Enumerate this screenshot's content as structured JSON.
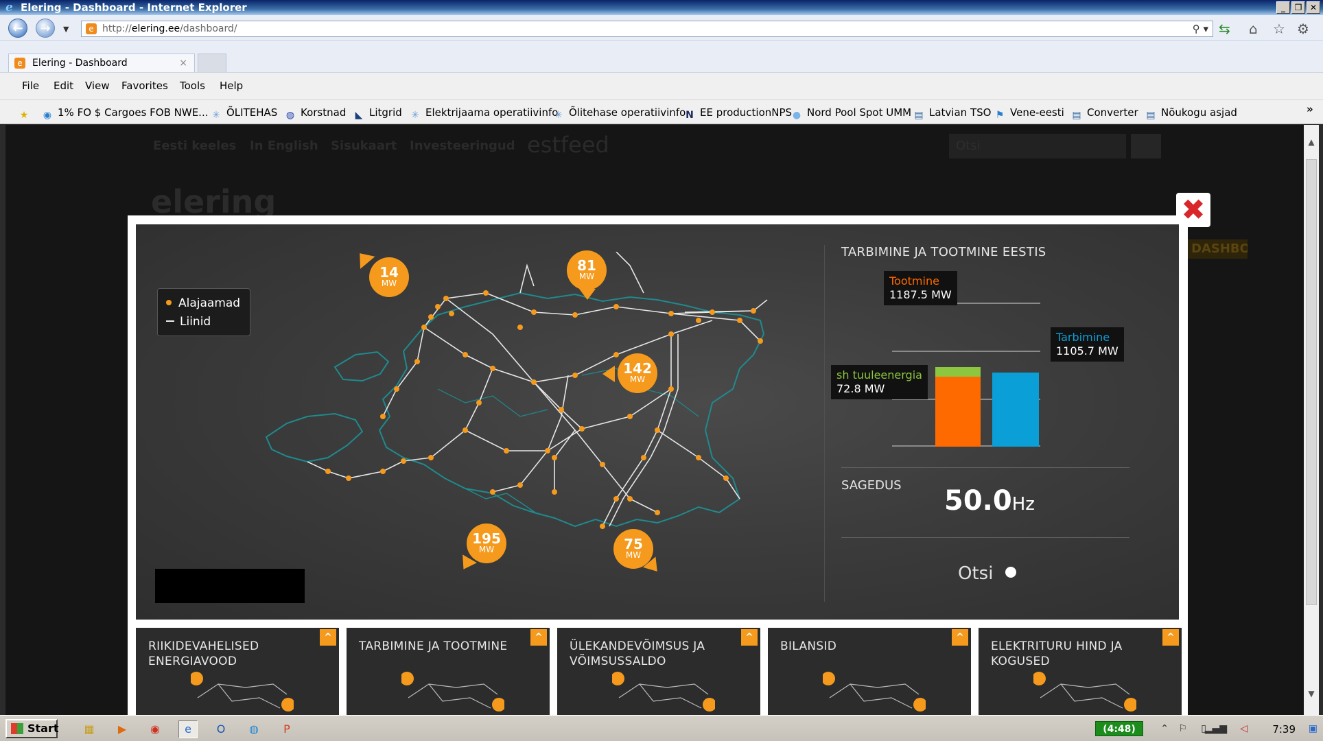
{
  "window": {
    "title": "Elering - Dashboard - Internet Explorer"
  },
  "address": {
    "url_prefix": "http://",
    "url_host": "elering.ee",
    "url_path": "/dashboard/"
  },
  "tab": {
    "label": "Elering - Dashboard"
  },
  "menu": [
    "File",
    "Edit",
    "View",
    "Favorites",
    "Tools",
    "Help"
  ],
  "favorites": [
    {
      "label": "1% FO $ Cargoes FOB NWE...",
      "icon": "globe-icon"
    },
    {
      "label": "ÕLITEHAS",
      "icon": "snowflake-icon"
    },
    {
      "label": "Korstnad",
      "icon": "chart-icon"
    },
    {
      "label": "Litgrid",
      "icon": "arrow-icon"
    },
    {
      "label": "Elektrijaama operatiivinfo",
      "icon": "snowflake-icon"
    },
    {
      "label": "Õlitehase operatiivinfo",
      "icon": "snowflake-icon"
    },
    {
      "label": "EE productionNPS",
      "icon": "n-icon"
    },
    {
      "label": "Nord Pool Spot UMM",
      "icon": "circle-icon"
    },
    {
      "label": "Latvian TSO",
      "icon": "ie-page-icon"
    },
    {
      "label": "Vene-eesti",
      "icon": "flag-icon"
    },
    {
      "label": "Converter",
      "icon": "ie-page-icon"
    },
    {
      "label": "Nõukogu asjad",
      "icon": "ie-page-icon"
    }
  ],
  "background_page": {
    "nav": [
      "Eesti keeles",
      "In English",
      "Sisukaart",
      "Investeeringud"
    ],
    "brand": "elering",
    "partner": "estfeed",
    "search_placeholder": "Otsi",
    "tag": "DASHBOARD"
  },
  "legend": {
    "substations": "Alajaamad",
    "lines": "Liinid"
  },
  "flows": [
    {
      "value": "14",
      "unit": "MW"
    },
    {
      "value": "81",
      "unit": "MW"
    },
    {
      "value": "142",
      "unit": "MW"
    },
    {
      "value": "195",
      "unit": "MW"
    },
    {
      "value": "75",
      "unit": "MW"
    }
  ],
  "panel": {
    "title": "TARBIMINE JA TOOTMINE EESTIS",
    "production": {
      "label": "Tootmine",
      "value": "1187.5 MW"
    },
    "wind": {
      "label": "sh tuuleenergia",
      "value": "72.8 MW"
    },
    "consumption": {
      "label": "Tarbimine",
      "value": "1105.7 MW"
    },
    "frequency_label": "SAGEDUS",
    "frequency_value": "50.0",
    "frequency_unit": "Hz",
    "search_label": "Otsi"
  },
  "chart_data": {
    "type": "bar",
    "categories": [
      "Tootmine",
      "Tarbimine"
    ],
    "series": [
      {
        "name": "Tootmine",
        "values": [
          1187.5,
          null
        ]
      },
      {
        "name": "sh tuuleenergia",
        "values": [
          72.8,
          null
        ]
      },
      {
        "name": "Tarbimine",
        "values": [
          null,
          1105.7
        ]
      }
    ],
    "colors": {
      "production": "#ff6a00",
      "wind": "#8dc63f",
      "consumption": "#0b9fd8"
    }
  },
  "tiles": [
    {
      "title_1": "RIIKIDEVAHELISED",
      "title_2": "ENERGIAVOOD"
    },
    {
      "title_1": "TARBIMINE JA TOOTMINE",
      "title_2": ""
    },
    {
      "title_1": "ÜLEKANDEVÕIMSUS JA",
      "title_2": "VÕIMSUSSALDO"
    },
    {
      "title_1": "BILANSID",
      "title_2": ""
    },
    {
      "title_1": "ELEKTRITURU HIND JA",
      "title_2": "KOGUSED"
    }
  ],
  "taskbar": {
    "start": "Start",
    "battery": "(4:48)",
    "clock": "7:39"
  },
  "accent": "#f59a1c"
}
